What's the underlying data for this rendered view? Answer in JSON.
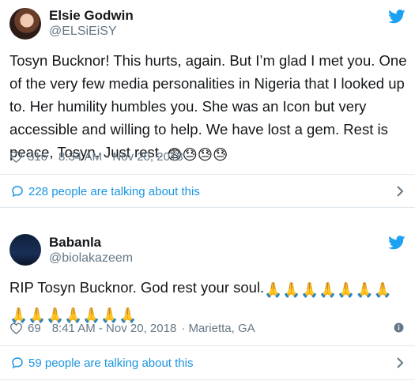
{
  "tweets": [
    {
      "author_name": "Elsie Godwin",
      "author_handle": "@ELSiEiSY",
      "text": "Tosyn Bucknor! This hurts, again. But I’m glad I met you. One of the very few media personalities in Nigeria that I looked up to. Her humility humbles you. She was an Icon but very accessible and willing to help. We have lost a gem. Rest is peace, Tosyn. Just rest.",
      "emojis": [
        "😨",
        "😓",
        "😓",
        "😓"
      ],
      "likes": "316",
      "timestamp": "8:34 AM - Nov 20, 2018",
      "talking_text": "228 people are talking about this"
    },
    {
      "author_name": "Babanla",
      "author_handle": "@biolakazeem",
      "text": "RIP Tosyn Bucknor. God rest your soul.",
      "emojis": [
        "🙏",
        "🙏",
        "🙏",
        "🙏",
        "🙏",
        "🙏",
        "🙏",
        "🙏",
        "🙏",
        "🙏",
        "🙏",
        "🙏",
        "🙏",
        "🙏"
      ],
      "likes": "69",
      "timestamp": "8:41 AM - Nov 20, 2018",
      "location": "· Marietta, GA",
      "talking_text": "59 people are talking about this"
    }
  ],
  "colors": {
    "accent": "#1b95e0",
    "twitter_blue": "#1da1f2",
    "muted": "#657786",
    "border": "#e1e8ed"
  },
  "icons": {
    "brand": "twitter-bird-icon",
    "like": "heart-icon",
    "comment": "speech-bubble-icon",
    "more": "chevron-right-icon",
    "info": "info-icon"
  }
}
